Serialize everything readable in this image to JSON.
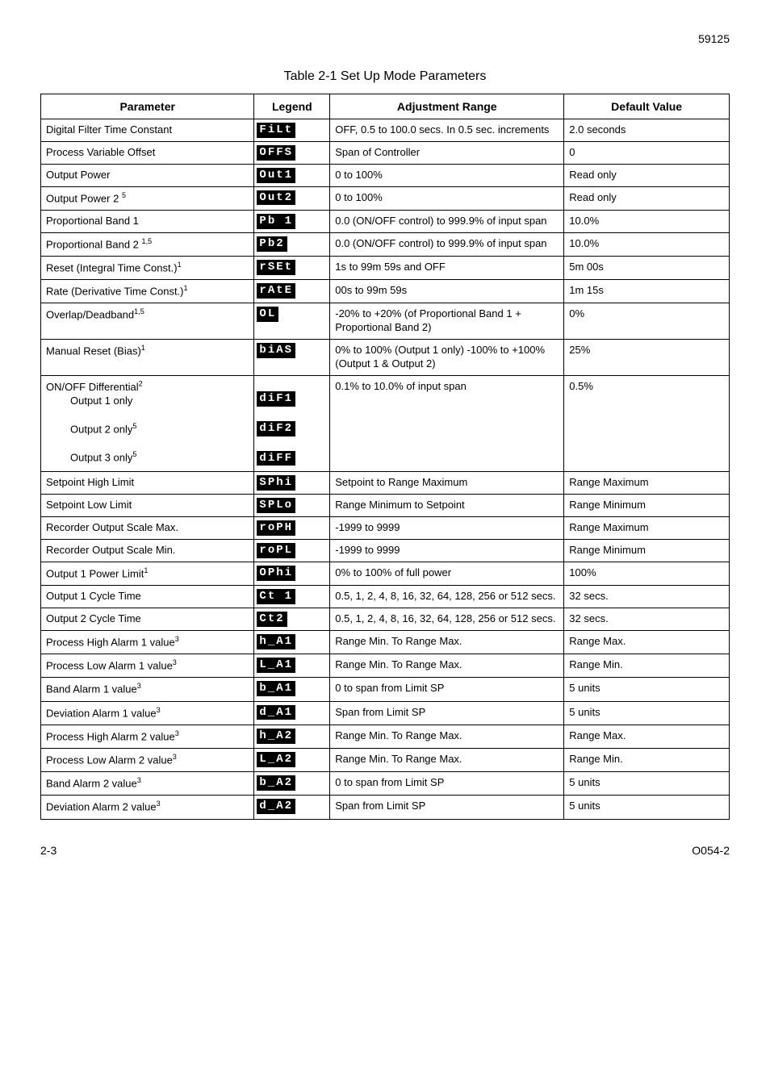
{
  "header": {
    "pageTop": "59125"
  },
  "title": "Table 2-1   Set Up Mode Parameters",
  "columns": [
    "Parameter",
    "Legend",
    "Adjustment Range",
    "Default Value"
  ],
  "rows": [
    {
      "param": "Digital Filter Time Constant",
      "legend": "FiLt",
      "range": "OFF, 0.5 to 100.0 secs. In 0.5 sec. increments",
      "def": "2.0 seconds"
    },
    {
      "param": "Process Variable Offset",
      "legend": "OFFS",
      "range": " Span of Controller",
      "def": "0"
    },
    {
      "param": "Output Power",
      "legend": "Out1",
      "range": "0 to 100%",
      "def": "Read only"
    },
    {
      "param": "Output Power 2 ",
      "sup": "5",
      "legend": "Out2",
      "range": "0 to 100%",
      "def": "Read only"
    },
    {
      "param": "Proportional Band 1",
      "legend": "Pb 1",
      "range": "0.0 (ON/OFF control) to 999.9% of input span",
      "def": "10.0%"
    },
    {
      "param": "Proportional Band 2 ",
      "sup": "1,5",
      "legend": "Pb2",
      "range": "0.0 (ON/OFF control) to 999.9% of input span",
      "def": "10.0%"
    },
    {
      "param": "Reset (Integral Time Const.)",
      "sup": "1",
      "legend": "rSEt",
      "range": "1s to 99m 59s and OFF",
      "def": "5m 00s"
    },
    {
      "param": "Rate (Derivative Time Const.)",
      "sup": "1",
      "legend": "rAtE",
      "range": "00s to 99m 59s",
      "def": "1m 15s"
    },
    {
      "param": "Overlap/Deadband",
      "sup": "1,5",
      "legend": "OL",
      "range": "-20% to +20% (of Proportional Band 1 + Proportional Band 2)",
      "def": "0%"
    },
    {
      "param": "Manual Reset (Bias)",
      "sup": "1",
      "legend": "biAS",
      "range": "0% to 100% (Output 1 only) -100% to +100% (Output 1 & Output 2)",
      "def": "25%"
    },
    {
      "type": "multi",
      "lines": [
        {
          "text": "ON/OFF Differential",
          "sup": "2"
        },
        {
          "text": "Output 1 only",
          "indent": true
        },
        {
          "text": "Output 2 only",
          "sup": "5",
          "indent": true,
          "pad": true
        },
        {
          "text": "Output 3 only",
          "sup": "5",
          "indent": true,
          "pad": true
        }
      ],
      "legends": [
        "diF1",
        "diF2",
        "diFF"
      ],
      "range": "0.1% to 10.0% of input span",
      "def": "0.5%"
    },
    {
      "param": "Setpoint High Limit",
      "legend": "SPhi",
      "range": "Setpoint to Range Maximum",
      "def": "Range Maximum"
    },
    {
      "param": "Setpoint Low Limit",
      "legend": "SPLo",
      "range": "Range Minimum to Setpoint",
      "def": "Range Minimum"
    },
    {
      "param": "Recorder Output Scale Max.",
      "legend": "roPH",
      "range": "-1999 to 9999",
      "def": "Range Maximum"
    },
    {
      "param": "Recorder Output Scale Min.",
      "legend": "roPL",
      "range": "-1999 to 9999",
      "def": "Range Minimum"
    },
    {
      "param": "Output 1 Power Limit",
      "sup": "1",
      "legend": "OPhi",
      "range": "0% to 100% of full power",
      "def": "100%"
    },
    {
      "param": "Output 1 Cycle Time",
      "legend": "Ct 1",
      "range": "0.5, 1, 2, 4, 8, 16, 32, 64, 128, 256 or 512 secs.",
      "def": "32 secs."
    },
    {
      "param": "Output 2 Cycle Time",
      "legend": "Ct2",
      "range": "0.5, 1, 2, 4, 8, 16, 32, 64, 128, 256 or 512 secs.",
      "def": "32 secs."
    },
    {
      "param": "Process High Alarm 1 value",
      "sup": "3",
      "legend": "h_A1",
      "range": "Range Min. To Range Max.",
      "def": "Range Max."
    },
    {
      "param": "Process Low Alarm 1 value",
      "sup": "3",
      "legend": "L_A1",
      "range": "Range Min. To Range Max.",
      "def": "Range Min."
    },
    {
      "param": "Band Alarm 1 value",
      "sup": "3",
      "legend": "b_A1",
      "range": "0 to span from Limit SP",
      "def": "5 units"
    },
    {
      "param": "Deviation Alarm 1 value",
      "sup": "3",
      "legend": "d_A1",
      "range": " Span from Limit SP",
      "def": "5 units"
    },
    {
      "param": "Process High Alarm 2 value",
      "sup": "3",
      "legend": "h_A2",
      "range": "Range Min. To Range Max.",
      "def": "Range Max."
    },
    {
      "param": "Process Low Alarm 2 value",
      "sup": "3",
      "legend": "L_A2",
      "range": "Range Min. To Range Max.",
      "def": "Range Min."
    },
    {
      "param": "Band Alarm 2 value",
      "sup": "3",
      "legend": "b_A2",
      "range": "0 to span from Limit SP",
      "def": "5 units"
    },
    {
      "param": "Deviation Alarm 2 value",
      "sup": "3",
      "legend": "d_A2",
      "range": " Span from Limit SP",
      "def": "5 units"
    }
  ],
  "footer": {
    "left": "2-3",
    "right": "O054-2"
  }
}
